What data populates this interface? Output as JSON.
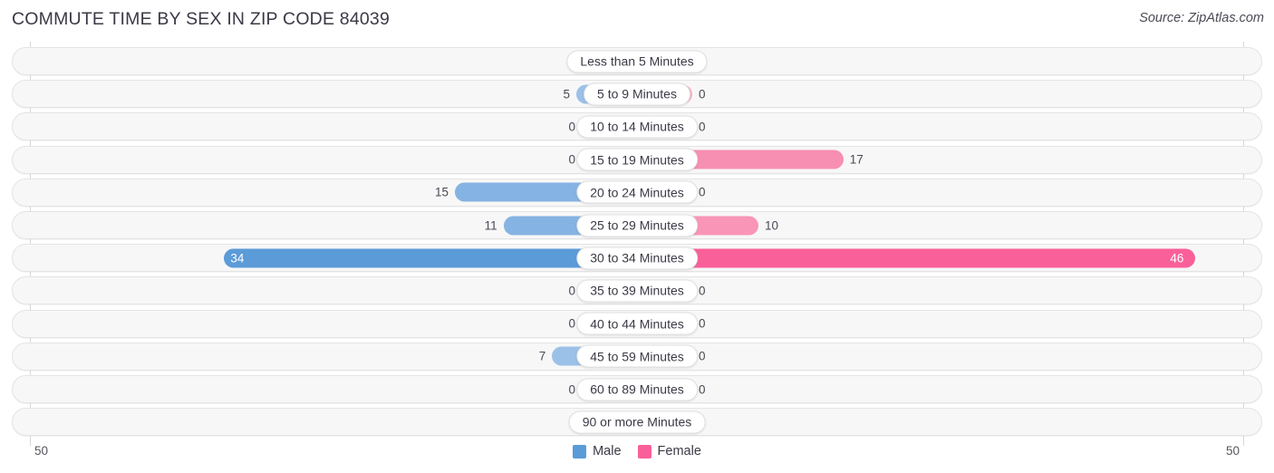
{
  "header": {
    "title": "COMMUTE TIME BY SEX IN ZIP CODE 84039",
    "source": "Source: ZipAtlas.com"
  },
  "legend": {
    "male_label": "Male",
    "female_label": "Female",
    "male_color": "#5b9bd8",
    "female_color": "#f9609a"
  },
  "axis": {
    "left_max": "50",
    "right_max": "50",
    "max_value": 50
  },
  "chart_data": {
    "type": "bar",
    "title": "COMMUTE TIME BY SEX IN ZIP CODE 84039",
    "subtitle": "Source: ZipAtlas.com",
    "orientation": "horizontal-diverging",
    "xlabel": "",
    "ylabel": "",
    "xlim": [
      -50,
      50
    ],
    "grid": true,
    "legend_position": "bottom-center",
    "categories": [
      "Less than 5 Minutes",
      "5 to 9 Minutes",
      "10 to 14 Minutes",
      "15 to 19 Minutes",
      "20 to 24 Minutes",
      "25 to 29 Minutes",
      "30 to 34 Minutes",
      "35 to 39 Minutes",
      "40 to 44 Minutes",
      "45 to 59 Minutes",
      "60 to 89 Minutes",
      "90 or more Minutes"
    ],
    "series": [
      {
        "name": "Male",
        "values": [
          0,
          5,
          0,
          0,
          15,
          11,
          34,
          0,
          0,
          7,
          0,
          0
        ]
      },
      {
        "name": "Female",
        "values": [
          0,
          0,
          0,
          17,
          0,
          10,
          46,
          0,
          0,
          0,
          0,
          0
        ]
      }
    ]
  },
  "rows": [
    {
      "label": "Less than 5 Minutes",
      "male": "0",
      "female": "0",
      "male_value": 0,
      "female_value": 0
    },
    {
      "label": "5 to 9 Minutes",
      "male": "5",
      "female": "0",
      "male_value": 5,
      "female_value": 0
    },
    {
      "label": "10 to 14 Minutes",
      "male": "0",
      "female": "0",
      "male_value": 0,
      "female_value": 0
    },
    {
      "label": "15 to 19 Minutes",
      "male": "0",
      "female": "17",
      "male_value": 0,
      "female_value": 17
    },
    {
      "label": "20 to 24 Minutes",
      "male": "15",
      "female": "0",
      "male_value": 15,
      "female_value": 0
    },
    {
      "label": "25 to 29 Minutes",
      "male": "11",
      "female": "10",
      "male_value": 11,
      "female_value": 10
    },
    {
      "label": "30 to 34 Minutes",
      "male": "34",
      "female": "46",
      "male_value": 34,
      "female_value": 46
    },
    {
      "label": "35 to 39 Minutes",
      "male": "0",
      "female": "0",
      "male_value": 0,
      "female_value": 0
    },
    {
      "label": "40 to 44 Minutes",
      "male": "0",
      "female": "0",
      "male_value": 0,
      "female_value": 0
    },
    {
      "label": "45 to 59 Minutes",
      "male": "7",
      "female": "0",
      "male_value": 7,
      "female_value": 0
    },
    {
      "label": "60 to 89 Minutes",
      "male": "0",
      "female": "0",
      "male_value": 0,
      "female_value": 0
    },
    {
      "label": "90 or more Minutes",
      "male": "0",
      "female": "0",
      "male_value": 0,
      "female_value": 0
    }
  ]
}
